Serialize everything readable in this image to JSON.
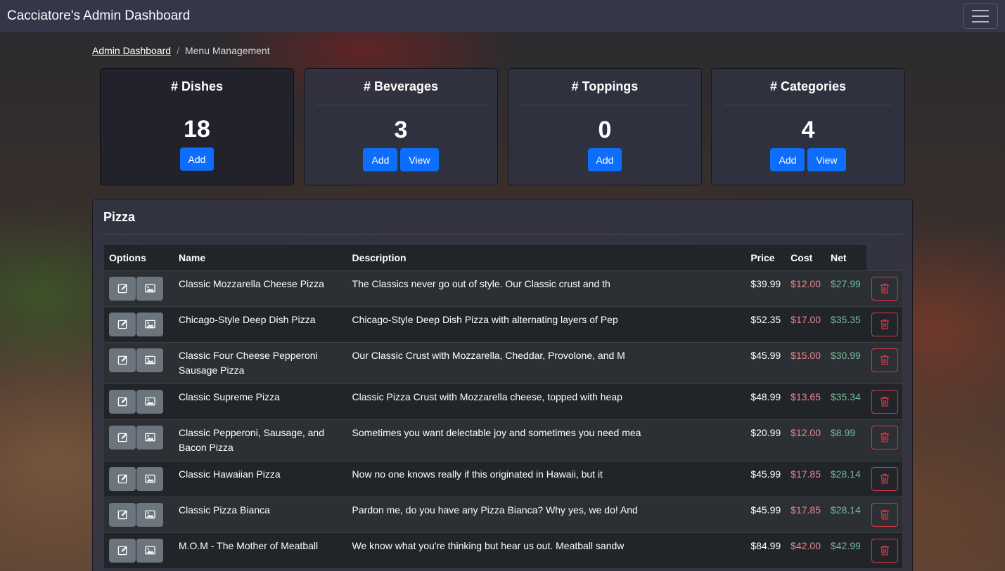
{
  "app": {
    "brand": "Cacciatore's Admin Dashboard",
    "menu_icon": "hamburger-menu-icon"
  },
  "breadcrumb": {
    "root": "Admin Dashboard",
    "separator": "/",
    "current": "Menu Management"
  },
  "stats": [
    {
      "title": "# Dishes",
      "value": "18",
      "add_label": "Add"
    },
    {
      "title": "# Beverages",
      "value": "3",
      "add_label": "Add",
      "view_label": "View"
    },
    {
      "title": "# Toppings",
      "value": "0",
      "add_label": "Add"
    },
    {
      "title": "# Categories",
      "value": "4",
      "add_label": "Add",
      "view_label": "View"
    }
  ],
  "section": {
    "title": "Pizza",
    "columns": {
      "options": "Options",
      "name": "Name",
      "description": "Description",
      "price": "Price",
      "cost": "Cost",
      "net": "Net"
    },
    "icons": {
      "edit": "edit-icon",
      "image": "image-icon",
      "delete": "trash-icon"
    },
    "rows": [
      {
        "name": "Classic Mozzarella Cheese Pizza",
        "description": "The Classics never go out of style. Our Classic crust and th",
        "price": "$39.99",
        "cost": "$12.00",
        "net": "$27.99"
      },
      {
        "name": "Chicago-Style Deep Dish Pizza",
        "description": "Chicago-Style Deep Dish Pizza with alternating layers of Pep",
        "price": "$52.35",
        "cost": "$17.00",
        "net": "$35.35"
      },
      {
        "name": "Classic Four Cheese Pepperoni Sausage Pizza",
        "description": "Our Classic Crust with Mozzarella, Cheddar, Provolone, and M",
        "price": "$45.99",
        "cost": "$15.00",
        "net": "$30.99"
      },
      {
        "name": "Classic Supreme Pizza",
        "description": "Classic Pizza Crust with Mozzarella cheese, topped with heap",
        "price": "$48.99",
        "cost": "$13.65",
        "net": "$35.34"
      },
      {
        "name": "Classic Pepperoni, Sausage, and Bacon Pizza",
        "description": "Sometimes you want delectable joy and sometimes you need mea",
        "price": "$20.99",
        "cost": "$12.00",
        "net": "$8.99"
      },
      {
        "name": "Classic Hawaiian Pizza",
        "description": "Now no one knows really if this originated in Hawaii, but it",
        "price": "$45.99",
        "cost": "$17.85",
        "net": "$28.14"
      },
      {
        "name": "Classic Pizza Bianca",
        "description": "Pardon me, do you have any Pizza Bianca? Why yes, we do! And",
        "price": "$45.99",
        "cost": "$17.85",
        "net": "$28.14"
      },
      {
        "name": "M.O.M - The Mother of Meatball",
        "description": "We know what you're thinking but hear us out. Meatball sandw",
        "price": "$84.99",
        "cost": "$42.00",
        "net": "$42.99"
      }
    ]
  },
  "colors": {
    "primary": "#0d6efd",
    "danger": "#dc3545",
    "cost": "#ea868f",
    "net": "#75b798"
  }
}
